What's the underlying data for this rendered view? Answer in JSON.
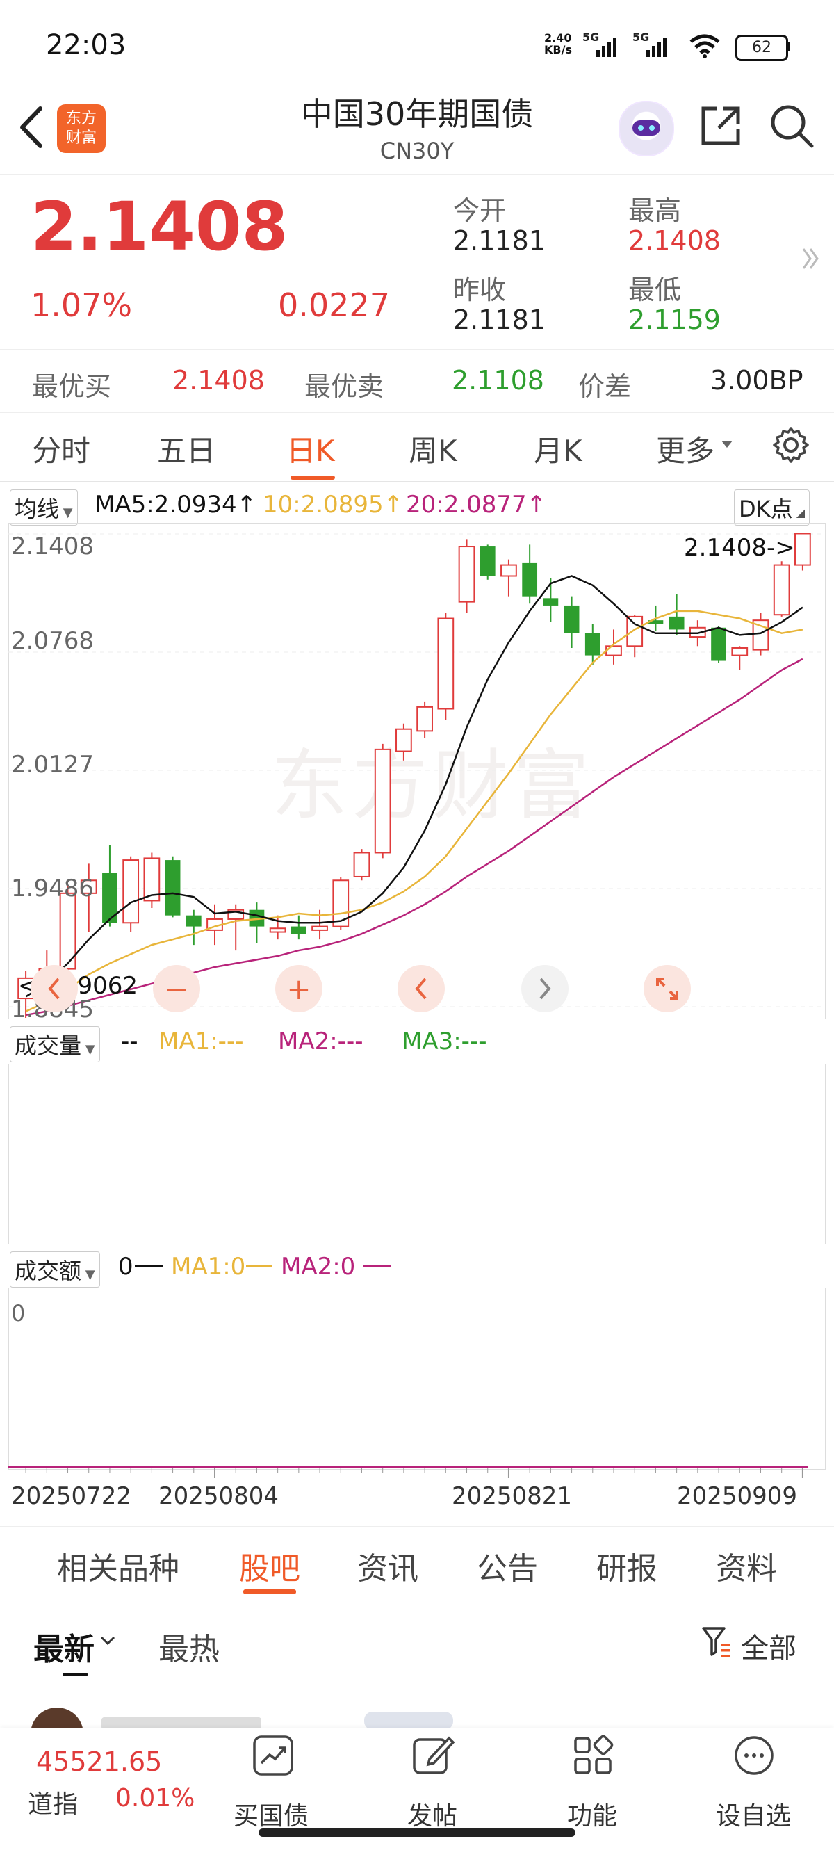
{
  "status": {
    "time": "22:03",
    "net_speed_top": "2.40",
    "net_speed_unit": "KB/s",
    "signal1": "5G",
    "signal2": "5G",
    "battery": "62"
  },
  "header": {
    "logo_line1": "东方",
    "logo_line2": "财富",
    "title": "中国30年期国债",
    "subtitle": "CN30Y"
  },
  "quote": {
    "price": "2.1408",
    "change_pct": "1.07%",
    "change": "0.0227",
    "open_label": "今开",
    "open": "2.1181",
    "high_label": "最高",
    "high": "2.1408",
    "prev_close_label": "昨收",
    "prev_close": "2.1181",
    "low_label": "最低",
    "low": "2.1159"
  },
  "best": {
    "bid_label": "最优买",
    "bid": "2.1408",
    "ask_label": "最优卖",
    "ask": "2.1108",
    "spread_label": "价差",
    "spread": "3.00BP"
  },
  "ktabs": [
    "分时",
    "五日",
    "日K",
    "周K",
    "月K",
    "更多"
  ],
  "ktab_active": "日K",
  "ma_row": {
    "selector": "均线",
    "ma5": "MA5:2.0934↑",
    "ma10": "10:2.0895↑",
    "ma20": "20:2.0877↑",
    "dk": "DK点"
  },
  "price_chart": {
    "y_labels": [
      "2.1408",
      "2.0768",
      "2.0127",
      "1.9486",
      "1.8845"
    ],
    "max_marker": "2.1408->",
    "min_marker": "<--1.9062",
    "watermark": "东方财富",
    "x_labels": [
      "20250722",
      "20250804",
      "20250821",
      "20250909"
    ]
  },
  "volume": {
    "selector": "成交量",
    "value": "--",
    "ma1": "MA1:---",
    "ma2": "MA2:---",
    "ma3": "MA3:---"
  },
  "turnover": {
    "selector": "成交额",
    "value": "0",
    "ma1": "MA1:0",
    "ma2": "MA2:0",
    "axis_zero": "0"
  },
  "section_tabs": [
    "相关品种",
    "股吧",
    "资讯",
    "公告",
    "研报",
    "资料"
  ],
  "section_active": "股吧",
  "feed": {
    "latest": "最新",
    "hot": "最热",
    "filter": "全部"
  },
  "bottom": {
    "index_value": "45521.65",
    "index_name": "道指",
    "index_change": "0.01%",
    "buy_label": "买国债",
    "post_label": "发帖",
    "func_label": "功能",
    "watch_label": "设自选"
  },
  "colors": {
    "up": "#e03b3b",
    "down": "#2e9e2e",
    "accent": "#f05a28",
    "ma5": "#111111",
    "ma10": "#e8b53a",
    "ma20": "#b8237a"
  },
  "chart_data": {
    "type": "candlestick",
    "ylim": [
      1.8845,
      2.1408
    ],
    "candles": [
      {
        "o": 1.889,
        "h": 1.904,
        "l": 1.878,
        "c": 1.9
      },
      {
        "o": 1.9,
        "h": 1.915,
        "l": 1.893,
        "c": 1.905
      },
      {
        "o": 1.905,
        "h": 1.95,
        "l": 1.898,
        "c": 1.946
      },
      {
        "o": 1.946,
        "h": 1.962,
        "l": 1.925,
        "c": 1.953
      },
      {
        "o": 1.957,
        "h": 1.972,
        "l": 1.928,
        "c": 1.93
      },
      {
        "o": 1.93,
        "h": 1.966,
        "l": 1.925,
        "c": 1.964
      },
      {
        "o": 1.942,
        "h": 1.968,
        "l": 1.938,
        "c": 1.965
      },
      {
        "o": 1.964,
        "h": 1.966,
        "l": 1.933,
        "c": 1.934
      },
      {
        "o": 1.934,
        "h": 1.937,
        "l": 1.918,
        "c": 1.928
      },
      {
        "o": 1.926,
        "h": 1.94,
        "l": 1.918,
        "c": 1.932
      },
      {
        "o": 1.932,
        "h": 1.94,
        "l": 1.915,
        "c": 1.937
      },
      {
        "o": 1.937,
        "h": 1.941,
        "l": 1.919,
        "c": 1.928
      },
      {
        "o": 1.925,
        "h": 1.934,
        "l": 1.921,
        "c": 1.927
      },
      {
        "o": 1.928,
        "h": 1.934,
        "l": 1.921,
        "c": 1.924
      },
      {
        "o": 1.926,
        "h": 1.937,
        "l": 1.921,
        "c": 1.928
      },
      {
        "o": 1.928,
        "h": 1.955,
        "l": 1.926,
        "c": 1.953
      },
      {
        "o": 1.955,
        "h": 1.97,
        "l": 1.953,
        "c": 1.968
      },
      {
        "o": 1.968,
        "h": 2.027,
        "l": 1.965,
        "c": 2.024
      },
      {
        "o": 2.023,
        "h": 2.038,
        "l": 2.018,
        "c": 2.035
      },
      {
        "o": 2.034,
        "h": 2.05,
        "l": 2.03,
        "c": 2.047
      },
      {
        "o": 2.046,
        "h": 2.098,
        "l": 2.04,
        "c": 2.095
      },
      {
        "o": 2.104,
        "h": 2.138,
        "l": 2.098,
        "c": 2.134
      },
      {
        "o": 2.134,
        "h": 2.135,
        "l": 2.116,
        "c": 2.118
      },
      {
        "o": 2.118,
        "h": 2.127,
        "l": 2.107,
        "c": 2.124
      },
      {
        "o": 2.125,
        "h": 2.135,
        "l": 2.103,
        "c": 2.107
      },
      {
        "o": 2.106,
        "h": 2.117,
        "l": 2.093,
        "c": 2.102
      },
      {
        "o": 2.102,
        "h": 2.107,
        "l": 2.079,
        "c": 2.087
      },
      {
        "o": 2.087,
        "h": 2.092,
        "l": 2.07,
        "c": 2.075
      },
      {
        "o": 2.075,
        "h": 2.089,
        "l": 2.07,
        "c": 2.08
      },
      {
        "o": 2.08,
        "h": 2.097,
        "l": 2.074,
        "c": 2.096
      },
      {
        "o": 2.094,
        "h": 2.102,
        "l": 2.088,
        "c": 2.092
      },
      {
        "o": 2.096,
        "h": 2.108,
        "l": 2.086,
        "c": 2.089
      },
      {
        "o": 2.085,
        "h": 2.094,
        "l": 2.08,
        "c": 2.09
      },
      {
        "o": 2.09,
        "h": 2.091,
        "l": 2.071,
        "c": 2.072
      },
      {
        "o": 2.075,
        "h": 2.08,
        "l": 2.067,
        "c": 2.079
      },
      {
        "o": 2.078,
        "h": 2.098,
        "l": 2.075,
        "c": 2.094
      },
      {
        "o": 2.097,
        "h": 2.126,
        "l": 2.096,
        "c": 2.124
      },
      {
        "o": 2.124,
        "h": 2.141,
        "l": 2.121,
        "c": 2.141
      }
    ],
    "ma5": [
      1.89,
      1.897,
      1.908,
      1.921,
      1.932,
      1.941,
      1.945,
      1.946,
      1.944,
      1.935,
      1.936,
      1.934,
      1.931,
      1.93,
      1.93,
      1.931,
      1.936,
      1.946,
      1.96,
      1.98,
      2.005,
      2.036,
      2.062,
      2.082,
      2.099,
      2.114,
      2.118,
      2.113,
      2.103,
      2.092,
      2.087,
      2.087,
      2.087,
      2.09,
      2.086,
      2.087,
      2.093,
      2.101
    ],
    "ma10": [
      1.882,
      1.887,
      1.894,
      1.902,
      1.908,
      1.913,
      1.918,
      1.921,
      1.924,
      1.928,
      1.931,
      1.932,
      1.933,
      1.935,
      1.934,
      1.935,
      1.937,
      1.941,
      1.947,
      1.955,
      1.966,
      1.981,
      1.996,
      2.011,
      2.027,
      2.043,
      2.057,
      2.071,
      2.081,
      2.089,
      2.095,
      2.099,
      2.099,
      2.097,
      2.095,
      2.091,
      2.087,
      2.089
    ],
    "ma20": [
      1.88,
      1.882,
      1.885,
      1.888,
      1.891,
      1.894,
      1.897,
      1.9,
      1.903,
      1.906,
      1.908,
      1.91,
      1.912,
      1.915,
      1.917,
      1.92,
      1.924,
      1.929,
      1.934,
      1.94,
      1.947,
      1.955,
      1.962,
      1.969,
      1.977,
      1.985,
      1.993,
      2.001,
      2.009,
      2.016,
      2.023,
      2.03,
      2.037,
      2.044,
      2.051,
      2.059,
      2.067,
      2.073
    ]
  }
}
